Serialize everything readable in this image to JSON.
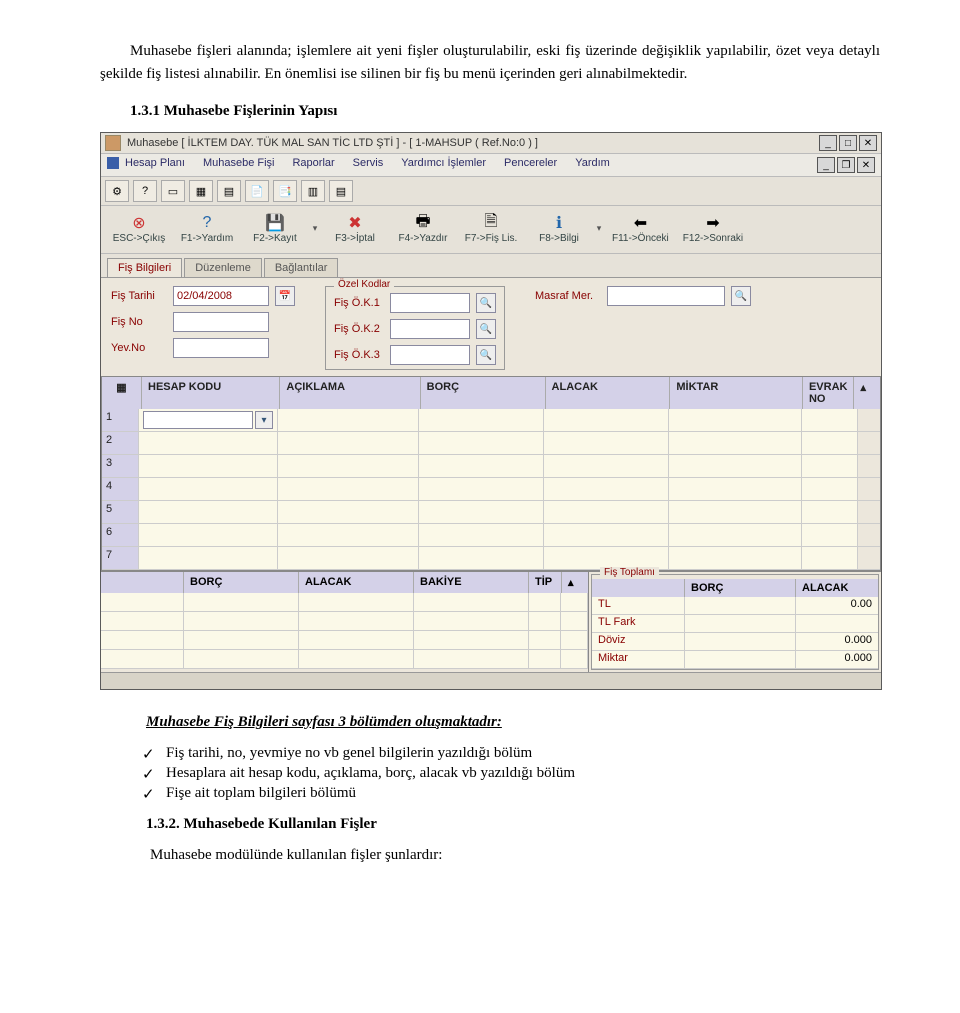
{
  "doc": {
    "para1": "Muhasebe fişleri alanında; işlemlere ait yeni fişler oluşturulabilir, eski fiş üzerinde değişiklik yapılabilir, özet veya detaylı şekilde fiş listesi alınabilir. En önemlisi ise silinen bir fiş bu menü içerinden geri alınabilmektedir.",
    "heading1": "1.3.1 Muhasebe Fişlerinin Yapısı",
    "subheading1": "Muhasebe Fiş Bilgileri sayfası 3 bölümden oluşmaktadır:",
    "bullets": [
      "Fiş tarihi, no, yevmiye no vb genel bilgilerin yazıldığı bölüm",
      "Hesaplara ait hesap kodu, açıklama, borç, alacak vb yazıldığı bölüm",
      "Fişe ait toplam bilgileri bölümü"
    ],
    "heading2": "1.3.2. Muhasebede Kullanılan Fişler",
    "para2": "Muhasebe modülünde kullanılan fişler şunlardır:"
  },
  "app": {
    "title": "Muhasebe [ İLKTEM DAY. TÜK MAL SAN TİC LTD ŞTİ ]  -  [ 1-MAHSUP ( Ref.No:0 ) ]",
    "menubar": [
      "Hesap Planı",
      "Muhasebe Fişi",
      "Raporlar",
      "Servis",
      "Yardımcı İşlemler",
      "Pencereler",
      "Yardım"
    ],
    "toolbar_icons": [
      "?",
      "?",
      "",
      "",
      "",
      "",
      "",
      "",
      ""
    ],
    "toolbar2": [
      {
        "glyph": "✖",
        "label": "ESC->Çıkış"
      },
      {
        "glyph": "?",
        "label": "F1->Yardım"
      },
      {
        "glyph": "💾",
        "label": "F2->Kayıt"
      },
      {
        "glyph": "↶",
        "label": "F3->İptal"
      },
      {
        "glyph": "🖨",
        "label": "F4->Yazdır"
      },
      {
        "glyph": "📄",
        "label": "F7->Fiş Lis."
      },
      {
        "glyph": "ℹ",
        "label": "F8->Bilgi"
      },
      {
        "glyph": "⬅",
        "label": "F11->Önceki"
      },
      {
        "glyph": "➡",
        "label": "F12->Sonraki"
      }
    ],
    "tabs": [
      "Fiş Bilgileri",
      "Düzenleme",
      "Bağlantılar"
    ],
    "form": {
      "fis_tarihi_label": "Fiş Tarihi",
      "fis_tarihi": "02/04/2008",
      "fis_no_label": "Fiş No",
      "fis_no": "",
      "yev_no_label": "Yev.No",
      "yev_no": "",
      "ozel_kodlar": "Özel Kodlar",
      "ok1_label": "Fiş Ö.K.1",
      "ok1": "",
      "ok2_label": "Fiş Ö.K.2",
      "ok2": "",
      "ok3_label": "Fiş Ö.K.3",
      "ok3": "",
      "masraf_label": "Masraf Mer.",
      "masraf": ""
    },
    "grid": {
      "cols": [
        "HESAP KODU",
        "AÇIKLAMA",
        "BORÇ",
        "ALACAK",
        "MİKTAR",
        "EVRAK NO"
      ],
      "rows": [
        "1",
        "2",
        "3",
        "4",
        "5",
        "6",
        "7"
      ]
    },
    "bottom_left_cols": [
      "",
      "BORÇ",
      "ALACAK",
      "BAKİYE",
      "TİP"
    ],
    "fis_toplam": {
      "legend": "Fiş Toplamı",
      "cols": [
        "",
        "BORÇ",
        "ALACAK"
      ],
      "rows": [
        {
          "label": "TL",
          "borc": "",
          "alacak": "0.00"
        },
        {
          "label": "TL Fark",
          "borc": "",
          "alacak": ""
        },
        {
          "label": "Döviz",
          "borc": "",
          "alacak": "0.000"
        },
        {
          "label": "Miktar",
          "borc": "",
          "alacak": "0.000"
        }
      ]
    }
  }
}
